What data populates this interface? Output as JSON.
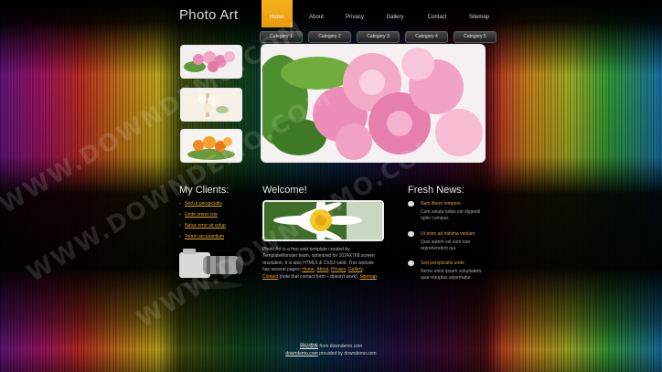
{
  "header": {
    "logo": "Photo Art",
    "nav": [
      {
        "label": "Home",
        "active": true
      },
      {
        "label": "About",
        "active": false
      },
      {
        "label": "Privacy",
        "active": false
      },
      {
        "label": "Gallery",
        "active": false
      },
      {
        "label": "Contact",
        "active": false
      },
      {
        "label": "Sitemap",
        "active": false
      }
    ]
  },
  "categories": [
    "Category 1",
    "Category 2",
    "Category 3",
    "Category 4",
    "Category 5"
  ],
  "clients": {
    "title": "My Clients:",
    "items": [
      "Sed ut perspiciatis",
      "Unde omnis iste",
      "Natus error sit volup",
      "Totam accusantium"
    ]
  },
  "welcome": {
    "title": "Welcome!",
    "text_lines": [
      "Photo Art is a free web template created by",
      "TemplateMonster team, optimized for 1024X768 screen",
      "resolution. It is also HTML5 & CSS3 valid. This website",
      "has several pages:"
    ],
    "pages": [
      "Home",
      "About",
      "Privacy",
      "Gallery"
    ],
    "contact_link": "Contact",
    "contact_rest": "(note that contact form – doesn't work),",
    "sitemap_link": "Sitemap"
  },
  "news": {
    "title": "Fresh News:",
    "items": [
      {
        "title": "Nam libero tempore",
        "body": [
          "Cum soluta nobis est eligendi",
          "optio cumque."
        ]
      },
      {
        "title": "Ut enim ad minima veniam",
        "body": [
          "Quis autem vel eum iure",
          "reprehenderit qui."
        ]
      },
      {
        "title": "Sed perspiciatis unde",
        "body": [
          "Nemo enim ipsam voluptatem",
          "quia voluptas aspernatur."
        ]
      }
    ]
  },
  "footer": {
    "line1_link": "网站模板",
    "line1_rest": "from downdemo.com",
    "line2_link": "downdemo.com",
    "line2_rest": "provided by downdemo.com"
  },
  "watermark": "WWW.DOWNDEMO.COM",
  "colors": {
    "accent": "#f7b21a",
    "link": "#e0a030"
  }
}
